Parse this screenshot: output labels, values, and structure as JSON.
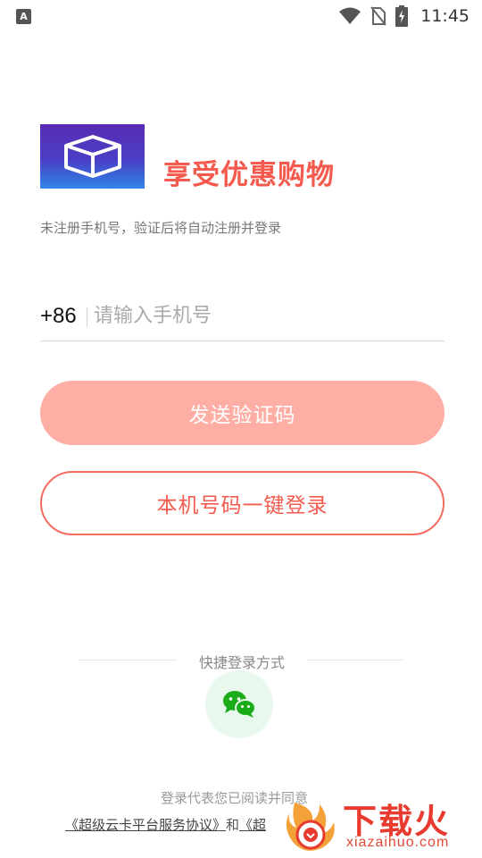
{
  "status_bar": {
    "app_badge": "A",
    "time": "11:45",
    "icons": [
      "wifi-icon",
      "no-sim-icon",
      "battery-charging-icon"
    ]
  },
  "brand": {
    "logo_icon": "box-3d-icon",
    "headline": "享受优惠购物",
    "subtitle": "未注册手机号，验证后将自动注册并登录"
  },
  "login_form": {
    "country_code": "+86",
    "phone_placeholder": "请输入手机号",
    "phone_value": "",
    "send_code_label": "发送验证码",
    "one_key_login_label": "本机号码一键登录"
  },
  "quick_login": {
    "label": "快捷登录方式",
    "providers": [
      "wechat-icon"
    ]
  },
  "agreement": {
    "line1": "登录代表您已阅读并同意",
    "link1": "《超级云卡平台服务协议》",
    "conjunction": "和",
    "link2_partial": "《超"
  },
  "watermark": {
    "text": "下载火",
    "sub": "xiazaihuo.com"
  },
  "colors": {
    "accent": "#f45a4e",
    "send_button_bg": "#ffaea6",
    "wechat_green": "#1aad19",
    "wechat_bg": "#e8f8ec"
  }
}
